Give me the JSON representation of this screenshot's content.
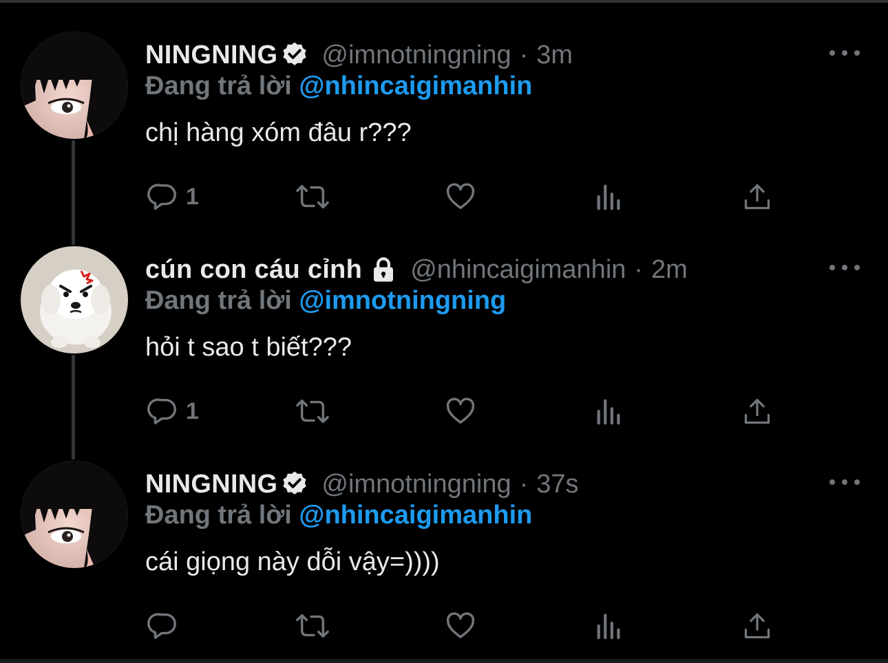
{
  "colors": {
    "background": "#000000",
    "text": "#e7e9ea",
    "muted": "#71767b",
    "accent": "#1d9bf0",
    "thread_line": "#333639"
  },
  "tweets": [
    {
      "display_name": "NINGNING",
      "badge": "verified-icon",
      "handle": "@imnotningning",
      "separator": "·",
      "time": "3m",
      "reply_label": "Đang trả lời",
      "reply_target": "@nhincaigimanhin",
      "text": "chị hàng xóm đâu r???",
      "reply_count": "1"
    },
    {
      "display_name": "cún con cáu cỉnh",
      "badge": "lock-icon",
      "handle": "@nhincaigimanhin",
      "separator": "·",
      "time": "2m",
      "reply_label": "Đang trả lời",
      "reply_target": "@imnotningning",
      "text": "hỏi t sao t biết???",
      "reply_count": "1"
    },
    {
      "display_name": "NINGNING",
      "badge": "verified-icon",
      "handle": "@imnotningning",
      "separator": "·",
      "time": "37s",
      "reply_label": "Đang trả lời",
      "reply_target": "@nhincaigimanhin",
      "text": "cái giọng này dỗi vậy=))))",
      "reply_count": ""
    }
  ],
  "action_icons": [
    "reply-icon",
    "retweet-icon",
    "like-icon",
    "analytics-icon",
    "share-icon"
  ]
}
